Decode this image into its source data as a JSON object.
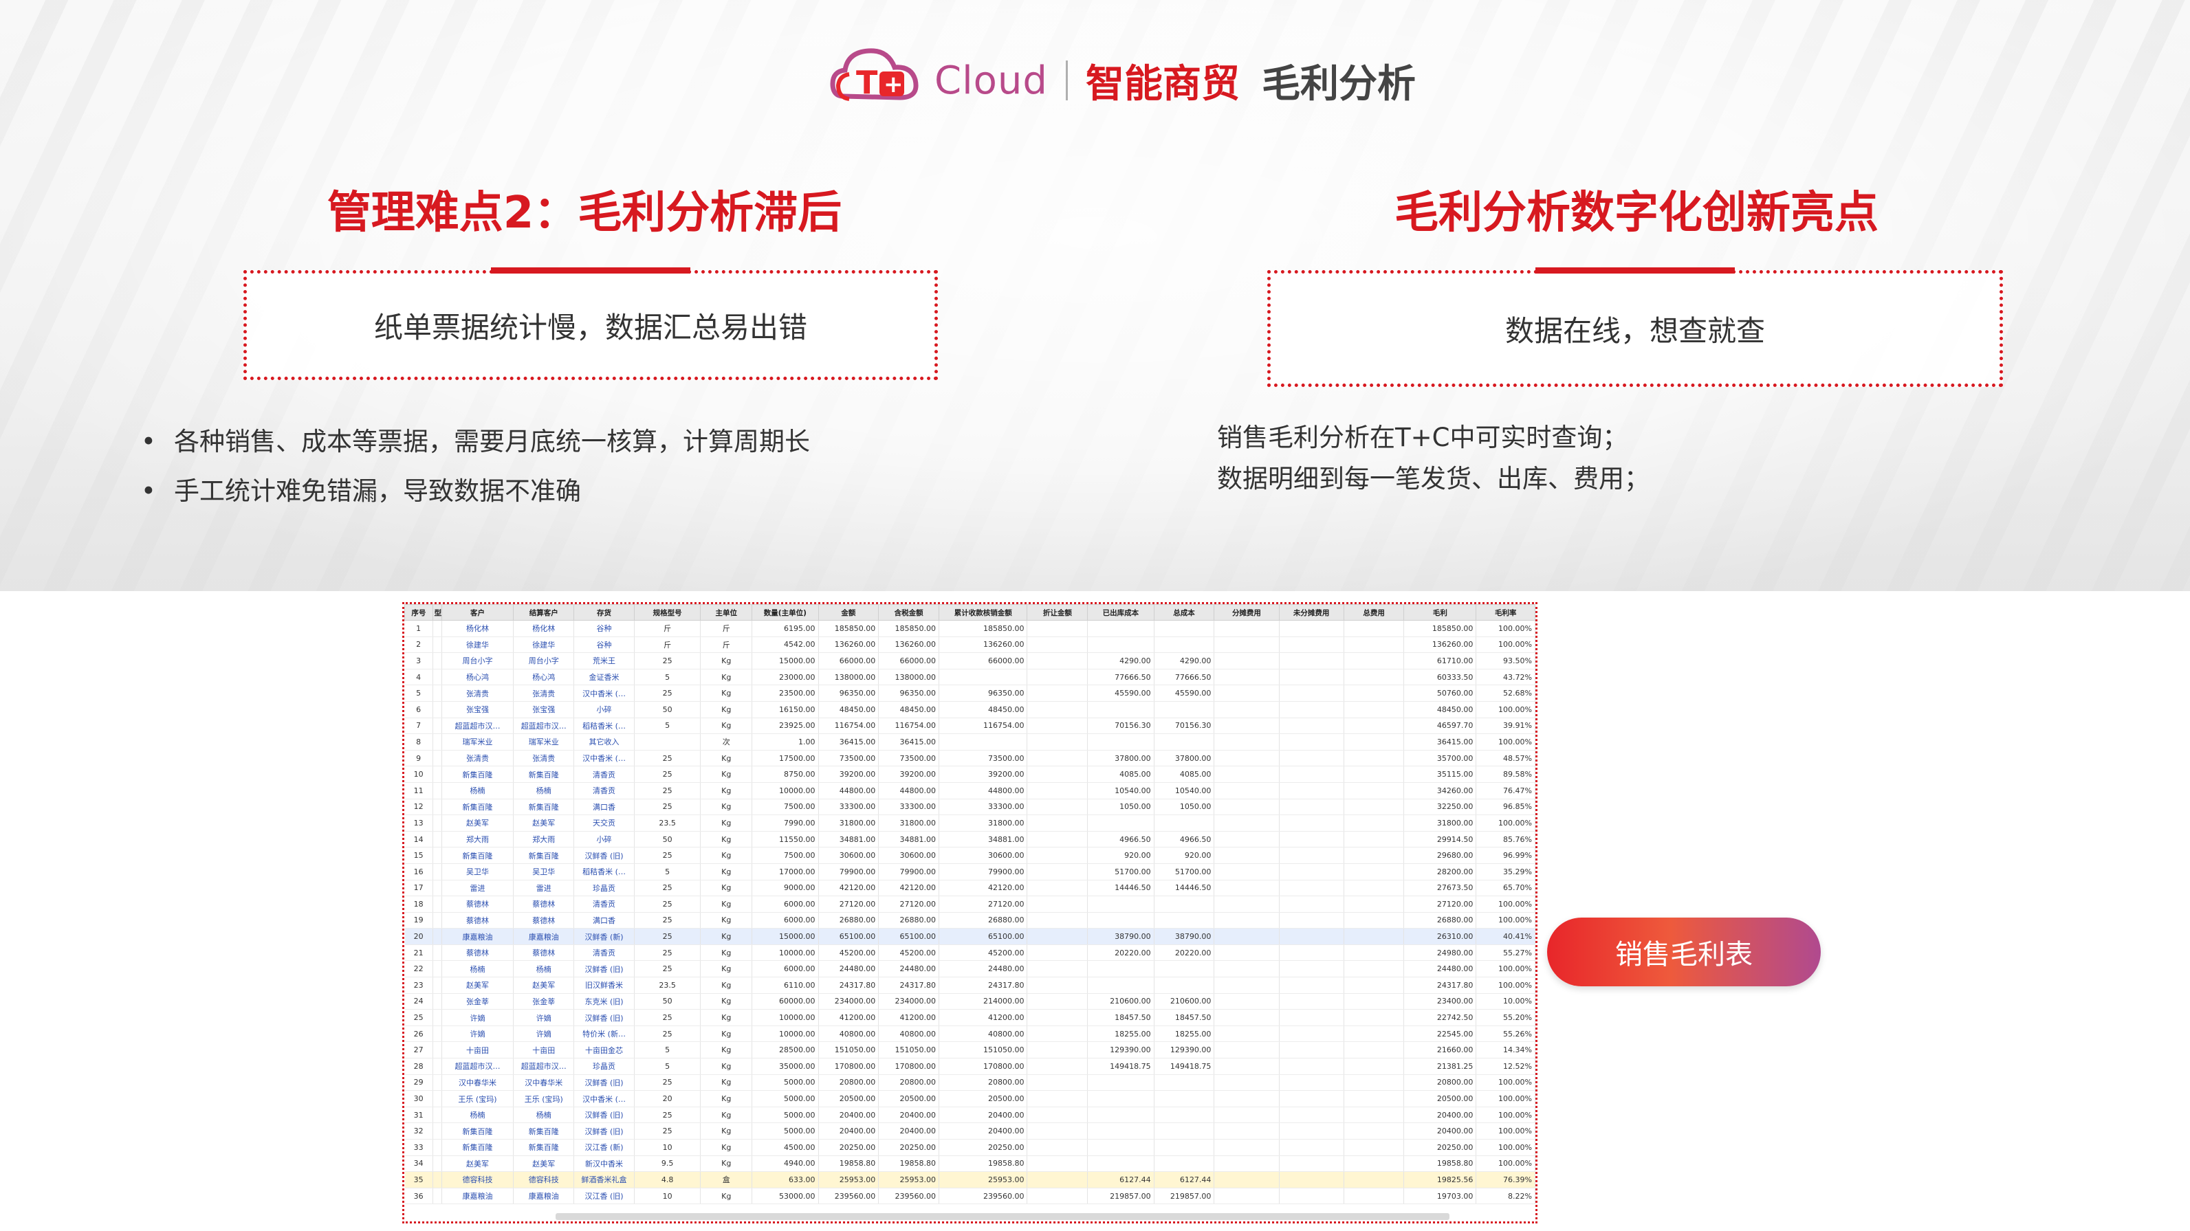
{
  "header": {
    "brand_cloud": "Cloud",
    "brand_name": "智能商贸",
    "page_title": "毛利分析"
  },
  "left": {
    "title": "管理难点2：毛利分析滞后",
    "box_text": "纸单票据统计慢，数据汇总易出错",
    "bullets": [
      "各种销售、成本等票据，需要月底统一核算，计算周期长",
      "手工统计难免错漏，导致数据不准确"
    ]
  },
  "right": {
    "title": "毛利分析数字化创新亮点",
    "box_text": "数据在线，想查就查",
    "lines": [
      "销售毛利分析在T+C中可实时查询；",
      "数据明细到每一笔发货、出库、费用；"
    ]
  },
  "button": {
    "label": "销售毛利表"
  },
  "colors": {
    "accent": "#d71920",
    "gradient_end": "#b04a8f"
  },
  "table": {
    "columns": [
      "序号",
      "型",
      "客户",
      "结算客户",
      "存货",
      "规格型号",
      "主单位",
      "数量(主单位)",
      "金额",
      "含税金额",
      "累计收款核销金额",
      "折让金额",
      "已出库成本",
      "总成本",
      "分摊费用",
      "未分摊费用",
      "总费用",
      "毛利",
      "毛利率"
    ],
    "rows": [
      [
        "1",
        "",
        "杨化林",
        "杨化林",
        "谷种",
        "斤",
        "斤",
        "6195.00",
        "185850.00",
        "185850.00",
        "185850.00",
        "",
        "",
        "",
        "",
        "",
        "",
        "185850.00",
        "100.00%"
      ],
      [
        "2",
        "",
        "徐建华",
        "徐建华",
        "谷种",
        "斤",
        "斤",
        "4542.00",
        "136260.00",
        "136260.00",
        "136260.00",
        "",
        "",
        "",
        "",
        "",
        "",
        "136260.00",
        "100.00%"
      ],
      [
        "3",
        "",
        "周台小字",
        "周台小字",
        "荒米王",
        "25",
        "Kg",
        "15000.00",
        "66000.00",
        "66000.00",
        "66000.00",
        "",
        "4290.00",
        "4290.00",
        "",
        "",
        "",
        "61710.00",
        "93.50%"
      ],
      [
        "4",
        "",
        "杨心鸿",
        "杨心鸿",
        "金证香米",
        "5",
        "Kg",
        "23000.00",
        "138000.00",
        "138000.00",
        "",
        "",
        "77666.50",
        "77666.50",
        "",
        "",
        "",
        "60333.50",
        "43.72%"
      ],
      [
        "5",
        "",
        "张清贵",
        "张清贵",
        "汉中香米 (…",
        "25",
        "Kg",
        "23500.00",
        "96350.00",
        "96350.00",
        "96350.00",
        "",
        "45590.00",
        "45590.00",
        "",
        "",
        "",
        "50760.00",
        "52.68%"
      ],
      [
        "6",
        "",
        "张宝强",
        "张宝强",
        "小碎",
        "50",
        "Kg",
        "16150.00",
        "48450.00",
        "48450.00",
        "48450.00",
        "",
        "",
        "",
        "",
        "",
        "",
        "48450.00",
        "100.00%"
      ],
      [
        "7",
        "",
        "超蓝超市汉…",
        "超蓝超市汉…",
        "稻秸香米 (…",
        "5",
        "Kg",
        "23925.00",
        "116754.00",
        "116754.00",
        "116754.00",
        "",
        "70156.30",
        "70156.30",
        "",
        "",
        "",
        "46597.70",
        "39.91%"
      ],
      [
        "8",
        "",
        "瑞军米业",
        "瑞军米业",
        "其它收入",
        "",
        "次",
        "1.00",
        "36415.00",
        "36415.00",
        "",
        "",
        "",
        "",
        "",
        "",
        "",
        "36415.00",
        "100.00%"
      ],
      [
        "9",
        "",
        "张清贵",
        "张清贵",
        "汉中香米 (…",
        "25",
        "Kg",
        "17500.00",
        "73500.00",
        "73500.00",
        "73500.00",
        "",
        "37800.00",
        "37800.00",
        "",
        "",
        "",
        "35700.00",
        "48.57%"
      ],
      [
        "10",
        "",
        "新集百隆",
        "新集百隆",
        "清香贡",
        "25",
        "Kg",
        "8750.00",
        "39200.00",
        "39200.00",
        "39200.00",
        "",
        "4085.00",
        "4085.00",
        "",
        "",
        "",
        "35115.00",
        "89.58%"
      ],
      [
        "11",
        "",
        "杨楠",
        "杨楠",
        "清香贡",
        "25",
        "Kg",
        "10000.00",
        "44800.00",
        "44800.00",
        "44800.00",
        "",
        "10540.00",
        "10540.00",
        "",
        "",
        "",
        "34260.00",
        "76.47%"
      ],
      [
        "12",
        "",
        "新集百隆",
        "新集百隆",
        "满口香",
        "25",
        "Kg",
        "7500.00",
        "33300.00",
        "33300.00",
        "33300.00",
        "",
        "1050.00",
        "1050.00",
        "",
        "",
        "",
        "32250.00",
        "96.85%"
      ],
      [
        "13",
        "",
        "赵美军",
        "赵美军",
        "天交贡",
        "23.5",
        "Kg",
        "7990.00",
        "31800.00",
        "31800.00",
        "31800.00",
        "",
        "",
        "",
        "",
        "",
        "",
        "31800.00",
        "100.00%"
      ],
      [
        "14",
        "",
        "郑大雨",
        "郑大雨",
        "小碎",
        "50",
        "Kg",
        "11550.00",
        "34881.00",
        "34881.00",
        "34881.00",
        "",
        "4966.50",
        "4966.50",
        "",
        "",
        "",
        "29914.50",
        "85.76%"
      ],
      [
        "15",
        "",
        "新集百隆",
        "新集百隆",
        "汉鲜香 (旧)",
        "25",
        "Kg",
        "7500.00",
        "30600.00",
        "30600.00",
        "30600.00",
        "",
        "920.00",
        "920.00",
        "",
        "",
        "",
        "29680.00",
        "96.99%"
      ],
      [
        "16",
        "",
        "吴卫华",
        "吴卫华",
        "稻秸香米 (…",
        "5",
        "Kg",
        "17000.00",
        "79900.00",
        "79900.00",
        "79900.00",
        "",
        "51700.00",
        "51700.00",
        "",
        "",
        "",
        "28200.00",
        "35.29%"
      ],
      [
        "17",
        "",
        "雷进",
        "雷进",
        "珍晶贡",
        "25",
        "Kg",
        "9000.00",
        "42120.00",
        "42120.00",
        "42120.00",
        "",
        "14446.50",
        "14446.50",
        "",
        "",
        "",
        "27673.50",
        "65.70%"
      ],
      [
        "18",
        "",
        "蔡德林",
        "蔡德林",
        "清香贡",
        "25",
        "Kg",
        "6000.00",
        "27120.00",
        "27120.00",
        "27120.00",
        "",
        "",
        "",
        "",
        "",
        "",
        "27120.00",
        "100.00%"
      ],
      [
        "19",
        "",
        "蔡德林",
        "蔡德林",
        "满口香",
        "25",
        "Kg",
        "6000.00",
        "26880.00",
        "26880.00",
        "26880.00",
        "",
        "",
        "",
        "",
        "",
        "",
        "26880.00",
        "100.00%"
      ],
      [
        "20",
        "",
        "康嘉粮油",
        "康嘉粮油",
        "汉鲜香 (新)",
        "25",
        "Kg",
        "15000.00",
        "65100.00",
        "65100.00",
        "65100.00",
        "",
        "38790.00",
        "38790.00",
        "",
        "",
        "",
        "26310.00",
        "40.41%"
      ],
      [
        "21",
        "",
        "蔡德林",
        "蔡德林",
        "清香贡",
        "25",
        "Kg",
        "10000.00",
        "45200.00",
        "45200.00",
        "45200.00",
        "",
        "20220.00",
        "20220.00",
        "",
        "",
        "",
        "24980.00",
        "55.27%"
      ],
      [
        "22",
        "",
        "杨楠",
        "杨楠",
        "汉鲜香 (旧)",
        "25",
        "Kg",
        "6000.00",
        "24480.00",
        "24480.00",
        "24480.00",
        "",
        "",
        "",
        "",
        "",
        "",
        "24480.00",
        "100.00%"
      ],
      [
        "23",
        "",
        "赵美军",
        "赵美军",
        "旧汉鲜香米",
        "23.5",
        "Kg",
        "6110.00",
        "24317.80",
        "24317.80",
        "24317.80",
        "",
        "",
        "",
        "",
        "",
        "",
        "24317.80",
        "100.00%"
      ],
      [
        "24",
        "",
        "张金莘",
        "张金莘",
        "东克米 (旧)",
        "50",
        "Kg",
        "60000.00",
        "234000.00",
        "234000.00",
        "214000.00",
        "",
        "210600.00",
        "210600.00",
        "",
        "",
        "",
        "23400.00",
        "10.00%"
      ],
      [
        "25",
        "",
        "许嫡",
        "许嫡",
        "汉鲜香 (旧)",
        "25",
        "Kg",
        "10000.00",
        "41200.00",
        "41200.00",
        "41200.00",
        "",
        "18457.50",
        "18457.50",
        "",
        "",
        "",
        "22742.50",
        "55.20%"
      ],
      [
        "26",
        "",
        "许嫡",
        "许嫡",
        "特价米 (新…",
        "25",
        "Kg",
        "10000.00",
        "40800.00",
        "40800.00",
        "40800.00",
        "",
        "18255.00",
        "18255.00",
        "",
        "",
        "",
        "22545.00",
        "55.26%"
      ],
      [
        "27",
        "",
        "十亩田",
        "十亩田",
        "十亩田金芯",
        "5",
        "Kg",
        "28500.00",
        "151050.00",
        "151050.00",
        "151050.00",
        "",
        "129390.00",
        "129390.00",
        "",
        "",
        "",
        "21660.00",
        "14.34%"
      ],
      [
        "28",
        "",
        "超蓝超市汉…",
        "超蓝超市汉…",
        "珍晶贡",
        "5",
        "Kg",
        "35000.00",
        "170800.00",
        "170800.00",
        "170800.00",
        "",
        "149418.75",
        "149418.75",
        "",
        "",
        "",
        "21381.25",
        "12.52%"
      ],
      [
        "29",
        "",
        "汉中春华米",
        "汉中春华米",
        "汉鲜香 (旧)",
        "25",
        "Kg",
        "5000.00",
        "20800.00",
        "20800.00",
        "20800.00",
        "",
        "",
        "",
        "",
        "",
        "",
        "20800.00",
        "100.00%"
      ],
      [
        "30",
        "",
        "王乐 (宝玛)",
        "王乐 (宝玛)",
        "汉中香米 (…",
        "20",
        "Kg",
        "5000.00",
        "20500.00",
        "20500.00",
        "20500.00",
        "",
        "",
        "",
        "",
        "",
        "",
        "20500.00",
        "100.00%"
      ],
      [
        "31",
        "",
        "杨楠",
        "杨楠",
        "汉鲜香 (旧)",
        "25",
        "Kg",
        "5000.00",
        "20400.00",
        "20400.00",
        "20400.00",
        "",
        "",
        "",
        "",
        "",
        "",
        "20400.00",
        "100.00%"
      ],
      [
        "32",
        "",
        "新集百隆",
        "新集百隆",
        "汉鲜香 (旧)",
        "25",
        "Kg",
        "5000.00",
        "20400.00",
        "20400.00",
        "20400.00",
        "",
        "",
        "",
        "",
        "",
        "",
        "20400.00",
        "100.00%"
      ],
      [
        "33",
        "",
        "新集百隆",
        "新集百隆",
        "汉江香 (新)",
        "10",
        "Kg",
        "4500.00",
        "20250.00",
        "20250.00",
        "20250.00",
        "",
        "",
        "",
        "",
        "",
        "",
        "20250.00",
        "100.00%"
      ],
      [
        "34",
        "",
        "赵美军",
        "赵美军",
        "新汉中香米",
        "9.5",
        "Kg",
        "4940.00",
        "19858.80",
        "19858.80",
        "19858.80",
        "",
        "",
        "",
        "",
        "",
        "",
        "19858.80",
        "100.00%"
      ],
      [
        "35",
        "",
        "德容科技",
        "德容科技",
        "鲜酒香米礼盒",
        "4.8",
        "盒",
        "633.00",
        "25953.00",
        "25953.00",
        "25953.00",
        "",
        "6127.44",
        "6127.44",
        "",
        "",
        "",
        "19825.56",
        "76.39%"
      ],
      [
        "36",
        "",
        "康嘉粮油",
        "康嘉粮油",
        "汉江香 (旧)",
        "10",
        "Kg",
        "53000.00",
        "239560.00",
        "239560.00",
        "239560.00",
        "",
        "219857.00",
        "219857.00",
        "",
        "",
        "",
        "19703.00",
        "8.22%"
      ]
    ]
  }
}
